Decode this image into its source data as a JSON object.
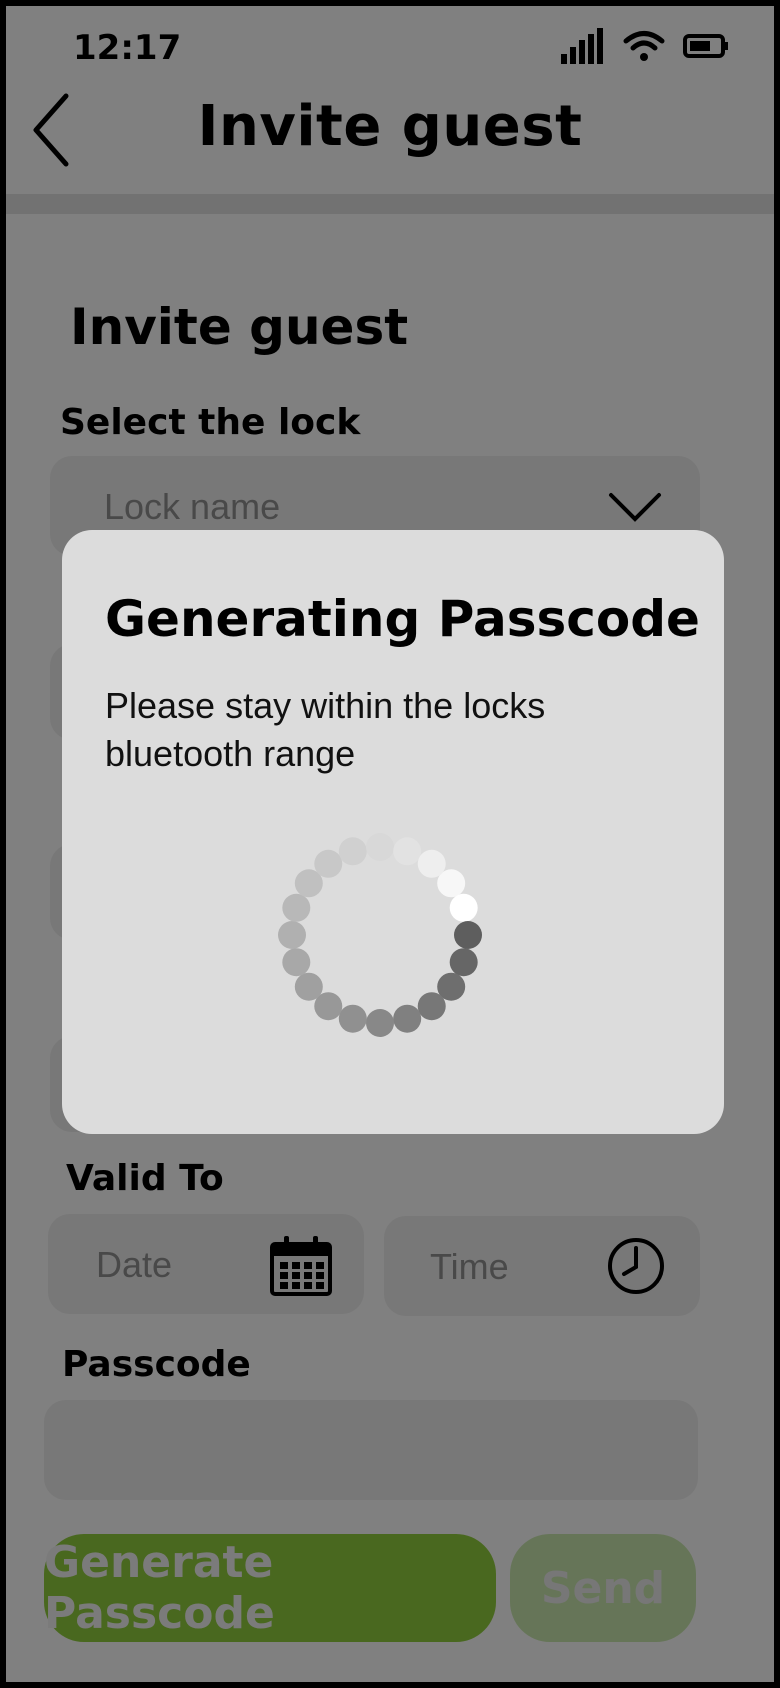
{
  "status": {
    "time": "12:17"
  },
  "nav": {
    "title": "Invite guest"
  },
  "form": {
    "section_title": "Invite guest",
    "lock_label": "Select the lock",
    "lock_placeholder": "Lock name",
    "valid_to_label": "Valid To",
    "date_placeholder": "Date",
    "time_placeholder": "Time",
    "passcode_label": "Passcode",
    "passcode_value": ""
  },
  "modal": {
    "title": "Generating Passcode",
    "message": "Please stay within the locks bluetooth range"
  },
  "actions": {
    "generate_label": "Generate Passcode",
    "send_label": "Send"
  },
  "colors": {
    "generate_button": "#8ac43b",
    "send_button": "#c0dea6",
    "field_bg": "#e3e3e3"
  },
  "icons": {
    "back": "chevron-left-icon",
    "dropdown": "chevron-down-icon",
    "calendar": "calendar-icon",
    "clock": "clock-icon",
    "spinner": "loading-spinner-icon"
  }
}
